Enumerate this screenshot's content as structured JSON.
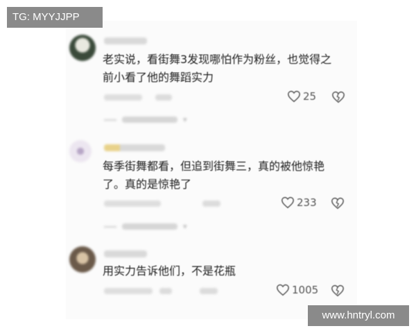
{
  "watermarks": {
    "top_left": "TG: MYYJJPP",
    "bottom_right": "www.hntryl.com"
  },
  "comments": [
    {
      "text_line1": "老实说，看街舞3发现哪怕作为粉丝，也觉得之",
      "text_line2": "前小看了他的舞蹈实力",
      "likes": "25",
      "avatar_color": "#3a4a3a"
    },
    {
      "text_line1": "每季街舞都看，但追到街舞三，真的被他惊艳",
      "text_line2": "了。真的是惊艳了",
      "likes": "233",
      "avatar_color": "#cdbcd8"
    },
    {
      "text_line1": "用实力告诉他们，不是花瓶",
      "text_line2": "",
      "likes": "1005",
      "avatar_color": "#6b5a4a"
    }
  ],
  "icons": {
    "like": "heart-outline-icon",
    "dislike": "broken-heart-icon",
    "expand": "chevron-down-icon"
  }
}
